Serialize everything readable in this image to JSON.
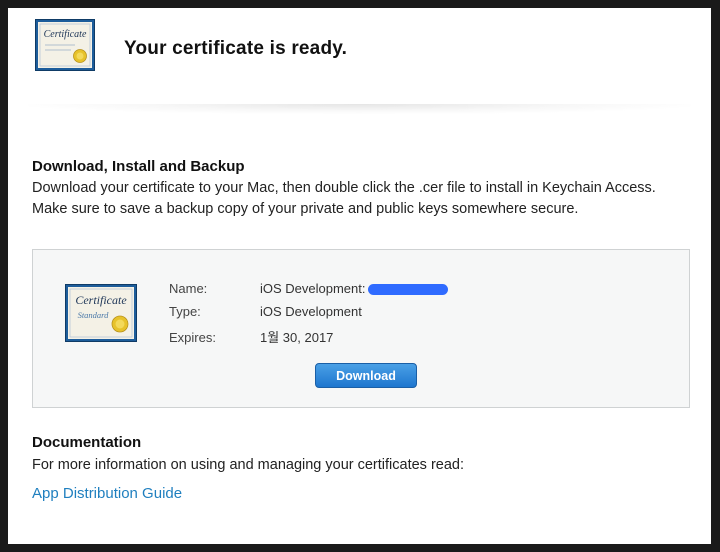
{
  "header": {
    "title": "Your certificate is ready.",
    "icon": "certificate-icon",
    "icon_label": "Certificate"
  },
  "download_section": {
    "heading": "Download, Install and Backup",
    "description": "Download your certificate to your Mac, then double click the .cer file to install in Keychain Access. Make sure to save a backup copy of your private and public keys somewhere secure."
  },
  "certificate": {
    "icon": "certificate-standard-icon",
    "icon_label": "Certificate",
    "icon_sublabel": "Standard",
    "rows": [
      {
        "label": "Name:",
        "value": "iOS Development:"
      },
      {
        "label": "Type:",
        "value": "iOS Development"
      },
      {
        "label": "Expires:",
        "value": "1월 30, 2017"
      }
    ],
    "download_label": "Download"
  },
  "documentation": {
    "heading": "Documentation",
    "text": "For more information on using and managing your certificates read:",
    "link_label": "App Distribution Guide"
  },
  "colors": {
    "accent_link": "#1f7fbf",
    "button": "#1d76cf",
    "redaction": "#2f6bff"
  }
}
